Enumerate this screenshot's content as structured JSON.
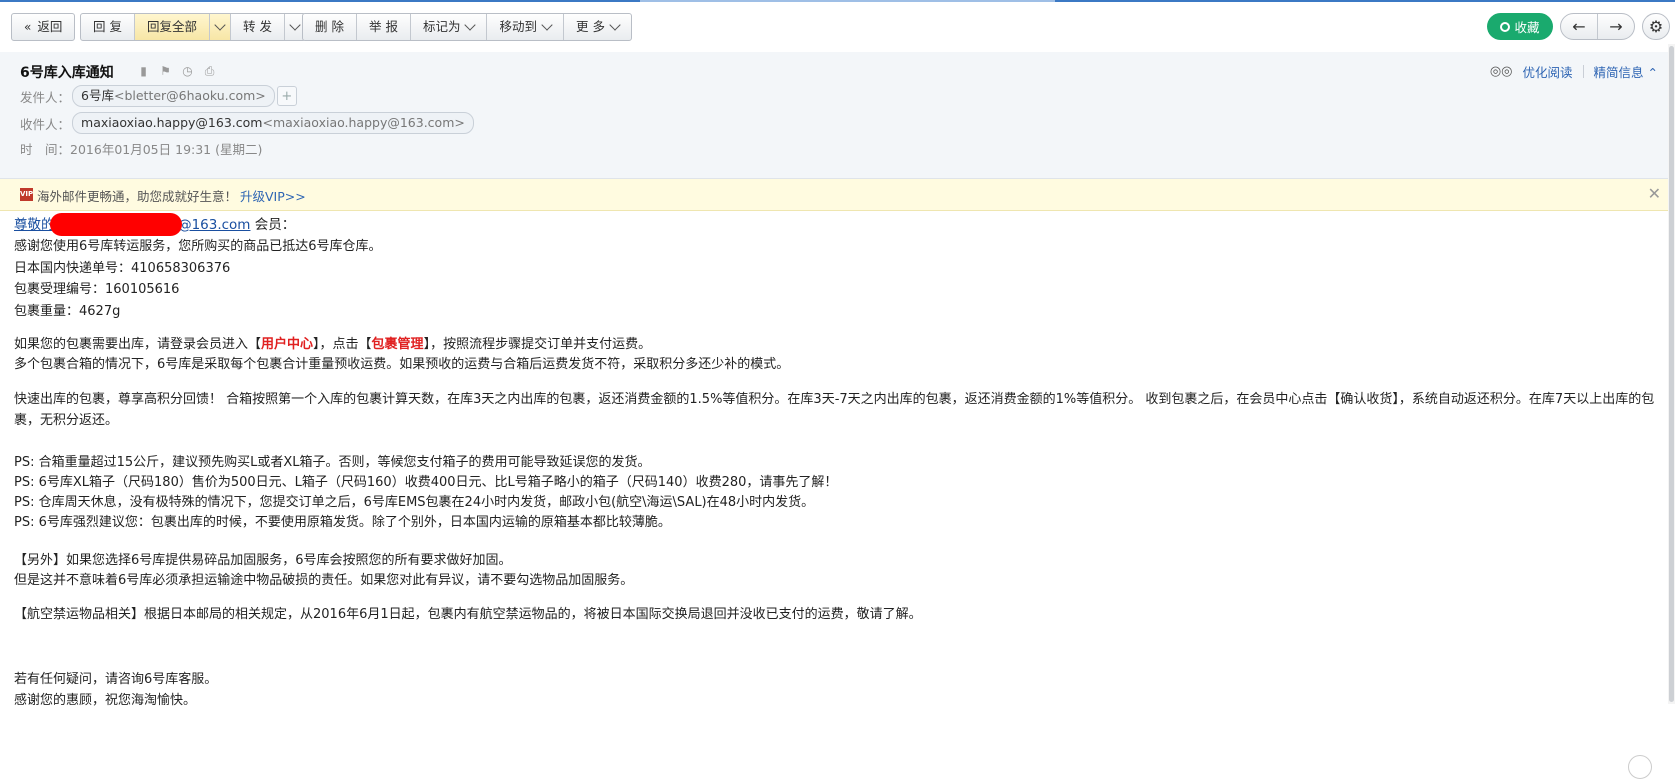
{
  "toolbar": {
    "back": "返回",
    "reply": "回 复",
    "reply_all": "回复全部",
    "forward": "转 发",
    "delete": "删 除",
    "report": "举 报",
    "mark_as": "标记为",
    "move_to": "移动到",
    "more": "更 多",
    "favorite": "收藏",
    "prev_icon": "←",
    "next_icon": "→",
    "settings_icon": "⚙"
  },
  "header": {
    "subject": "6号库入库通知",
    "optimize_read": "优化阅读",
    "simple_info": "精简信息",
    "sender_label": "发件人：",
    "sender_name": "6号库",
    "sender_addr": "<bletter@6haoku.com>",
    "recipient_label": "收件人：",
    "recipient_name": "maxiaoxiao.happy@163.com",
    "recipient_addr": "<maxiaoxiao.happy@163.com>",
    "time_label": "时　间：",
    "time_value": "2016年01月05日 19:31 (星期二)"
  },
  "vip_bar": {
    "badge": "VIP",
    "text": "海外邮件更畅通，助您成就好生意！",
    "link": "升级VIP>>"
  },
  "body": {
    "greeting_link": "尊敬的maxiaoxiao.happy@163.com",
    "greeting_suffix": " 会员：",
    "p1": "感谢您使用6号库转运服务，您所购买的商品已抵达6号库仓库。",
    "p2": "日本国内快递单号：410658306376",
    "p3": "包裹受理编号：160105616",
    "p4": "包裹重量：4627g",
    "p5a": "如果您的包裹需要出库，请登录会员进入【",
    "p5b": "用户中心",
    "p5c": "】，点击【",
    "p5d": "包裹管理",
    "p5e": "】，按照流程步骤提交订单并支付运费。",
    "p6": "多个包裹合箱的情况下，6号库是采取每个包裹合计重量预收运费。如果预收的运费与合箱后运费发货不符，采取积分多还少补的模式。",
    "p7": "快速出库的包裹，尊享高积分回馈！ 合箱按照第一个入库的包裹计算天数，在库3天之内出库的包裹，返还消费金额的1.5%等值积分。在库3天-7天之内出库的包裹，返还消费金额的1%等值积分。 收到包裹之后，在会员中心点击【确认收货】，系统自动返还积分。在库7天以上出库的包裹，无积分返还。",
    "p8": "PS: 合箱重量超过15公斤，建议预先购买L或者XL箱子。否则，等候您支付箱子的费用可能导致延误您的发货。",
    "p9": "PS: 6号库XL箱子（尺码180）售价为500日元、L箱子（尺码160）收费400日元、比L号箱子略小的箱子（尺码140）收费280，请事先了解！",
    "p10": "PS: 仓库周天休息，没有极特殊的情况下，您提交订单之后，6号库EMS包裹在24小时内发货，邮政小包(航空\\海运\\SAL)在48小时内发货。",
    "p11": "PS: 6号库强烈建议您：包裹出库的时候，不要使用原箱发货。除了个别外，日本国内运输的原箱基本都比较薄脆。",
    "p12": "【另外】如果您选择6号库提供易碎品加固服务，6号库会按照您的所有要求做好加固。",
    "p13": "但是这并不意味着6号库必须承担运输途中物品破损的责任。如果您对此有异议，请不要勾选物品加固服务。",
    "p14": "【航空禁运物品相关】根据日本邮局的相关规定，从2016年6月1日起，包裹内有航空禁运物品的，将被日本国际交换局退回并没收已支付的运费，敬请了解。",
    "p15": "若有任何疑问，请咨询6号库客服。",
    "p16": "感谢您的惠顾，祝您海淘愉快。"
  },
  "colors": {
    "accent_green": "#1aaa6e",
    "link_blue": "#2d64b3",
    "highlight_red": "#e02020"
  }
}
